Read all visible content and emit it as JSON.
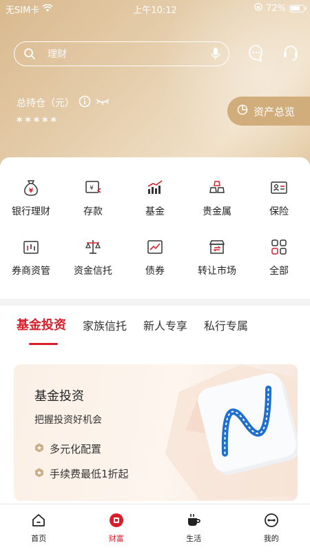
{
  "status_bar": {
    "carrier": "无SIM卡",
    "time": "上午10:12",
    "battery": "72%"
  },
  "search": {
    "placeholder": "理财"
  },
  "header": {
    "holding_label": "总持仓（元）",
    "holding_value": "*****",
    "overview_label": "资产总览"
  },
  "grid": [
    {
      "label": "银行理财",
      "icon": "money-bag-icon"
    },
    {
      "label": "存款",
      "icon": "deposit-icon"
    },
    {
      "label": "基金",
      "icon": "fund-chart-icon"
    },
    {
      "label": "贵金属",
      "icon": "gold-bars-icon"
    },
    {
      "label": "保险",
      "icon": "insurance-card-icon"
    },
    {
      "label": "券商资管",
      "icon": "broker-icon"
    },
    {
      "label": "资金信托",
      "icon": "scale-icon"
    },
    {
      "label": "债券",
      "icon": "bond-icon"
    },
    {
      "label": "转让市场",
      "icon": "market-icon"
    },
    {
      "label": "全部",
      "icon": "grid-icon"
    }
  ],
  "tabs": [
    "基金投资",
    "家族信托",
    "新人专享",
    "私行专属"
  ],
  "promo": {
    "title": "基金投资",
    "subtitle": "把握投资好机会",
    "features": [
      "多元化配置",
      "手续费最低1折起"
    ]
  },
  "tabbar": [
    {
      "label": "首页",
      "icon": "home-icon"
    },
    {
      "label": "财富",
      "icon": "wealth-icon"
    },
    {
      "label": "生活",
      "icon": "coffee-cup-icon"
    },
    {
      "label": "我的",
      "icon": "profile-icon"
    }
  ],
  "colors": {
    "accent": "#d81e2a",
    "gold": "#d2ad7c"
  }
}
